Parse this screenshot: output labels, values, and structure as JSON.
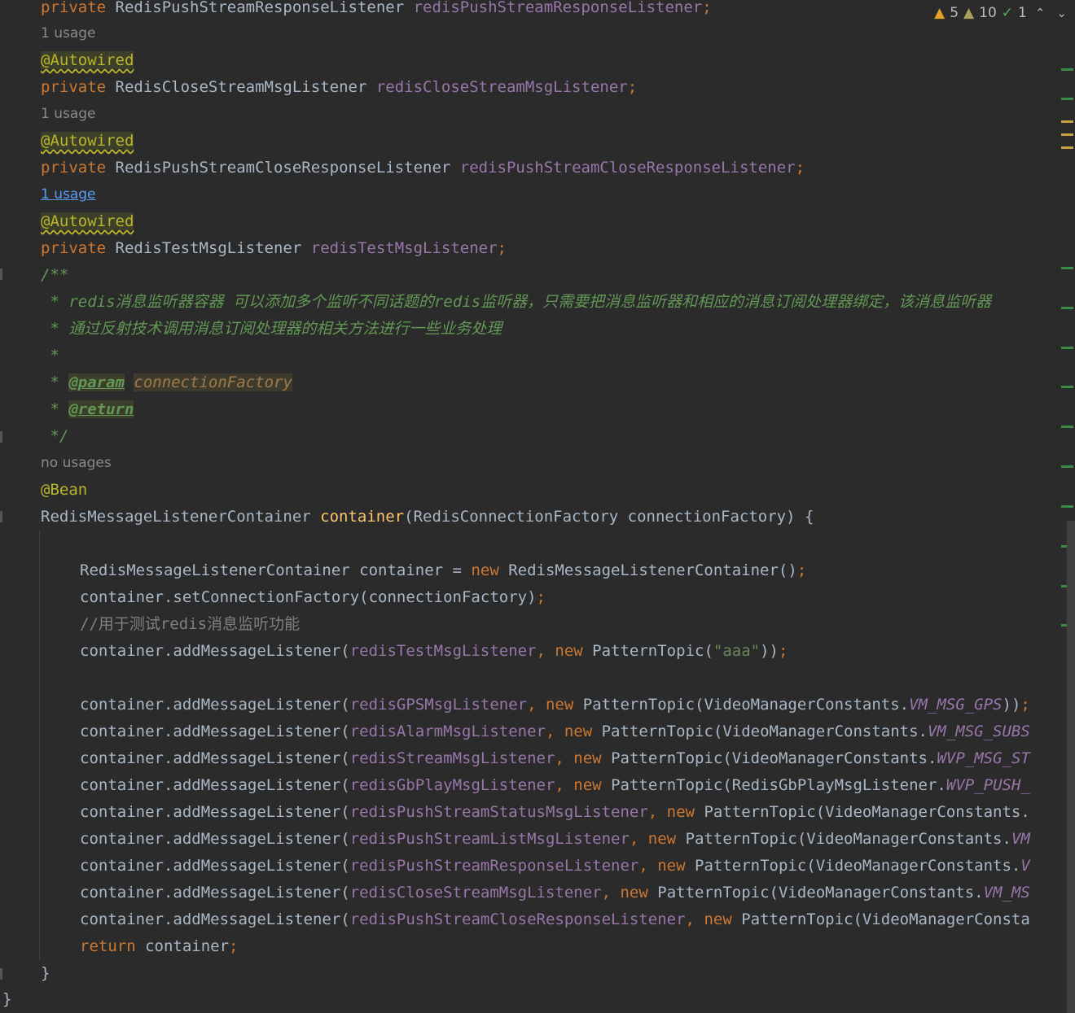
{
  "inspection": {
    "warnings": "5",
    "weak_warnings": "10",
    "typos": "1",
    "warn_icon": "warning-triangle-icon",
    "weak_icon": "weak-warning-triangle-icon",
    "typo_icon": "typo-check-icon",
    "prev_icon": "chevron-up-icon",
    "next_icon": "chevron-down-icon",
    "up_glyph": "⌃",
    "down_glyph": "⌄",
    "warn_glyph": "▲",
    "typo_glyph": "✓"
  },
  "code": {
    "l0": {
      "kw": "private",
      "type": "RedisPushStreamResponseListener",
      "field": "redisPushStreamResponseListener",
      "semi": ";"
    },
    "h1": "1 usage",
    "a1": "@Autowired",
    "l1": {
      "kw": "private",
      "type": "RedisCloseStreamMsgListener",
      "field": "redisCloseStreamMsgListener",
      "semi": ";"
    },
    "h2": "1 usage",
    "a2": "@Autowired",
    "l2": {
      "kw": "private",
      "type": "RedisPushStreamCloseResponseListener",
      "field": "redisPushStreamCloseResponseListener",
      "semi": ";"
    },
    "h3": "1 usage",
    "a3": "@Autowired",
    "l3": {
      "kw": "private",
      "type": "RedisTestMsgListener",
      "field": "redisTestMsgListener",
      "semi": ";"
    },
    "doc_open": "/**",
    "doc1": " * redis消息监听器容器 可以添加多个监听不同话题的redis监听器，只需要把消息监听器和相应的消息订阅处理器绑定，该消息监听器",
    "doc2": " * 通过反射技术调用消息订阅处理器的相关方法进行一些业务处理",
    "doc3": " *",
    "doc4_star": " * ",
    "doc4_tag": "@param",
    "doc4_name": "connectionFactory",
    "doc5_star": " * ",
    "doc5_tag": "@return",
    "doc_close": " */",
    "h4": "no usages",
    "bean": "@Bean",
    "sig": {
      "type": "RedisMessageListenerContainer ",
      "name": "container",
      "rest": "(RedisConnectionFactory connectionFactory) {"
    },
    "b1": {
      "a": "RedisMessageListenerContainer container = ",
      "kw": "new",
      "b": " RedisMessageListenerContainer()",
      "semi": ";"
    },
    "b2": {
      "a": "container.setConnectionFactory(connectionFactory)",
      "semi": ";"
    },
    "b3": "//用于测试redis消息监听功能",
    "b4": {
      "a": "container.addMessageListener(",
      "field": "redisTestMsgListener",
      "c": ", ",
      "kw": "new",
      "d": " PatternTopic(",
      "str": "\"aaa\"",
      "e": "))",
      "semi": ";"
    },
    "r1": {
      "a": "container.addMessageListener(",
      "field": "redisGPSMsgListener",
      "c": ", ",
      "kw": "new",
      "d": " PatternTopic(VideoManagerConstants.",
      "const": "VM_MSG_GPS",
      "e": "))",
      "semi": ";"
    },
    "r2": {
      "a": "container.addMessageListener(",
      "field": "redisAlarmMsgListener",
      "c": ", ",
      "kw": "new",
      "d": " PatternTopic(VideoManagerConstants.",
      "const": "VM_MSG_SUBS"
    },
    "r3": {
      "a": "container.addMessageListener(",
      "field": "redisStreamMsgListener",
      "c": ", ",
      "kw": "new",
      "d": " PatternTopic(VideoManagerConstants.",
      "const": "WVP_MSG_ST"
    },
    "r4": {
      "a": "container.addMessageListener(",
      "field": "redisGbPlayMsgListener",
      "c": ", ",
      "kw": "new",
      "d": " PatternTopic(RedisGbPlayMsgListener.",
      "const": "WVP_PUSH_"
    },
    "r5": {
      "a": "container.addMessageListener(",
      "field": "redisPushStreamStatusMsgListener",
      "c": ", ",
      "kw": "new",
      "d": " PatternTopic(VideoManagerConstants."
    },
    "r6": {
      "a": "container.addMessageListener(",
      "field": "redisPushStreamListMsgListener",
      "c": ", ",
      "kw": "new",
      "d": " PatternTopic(VideoManagerConstants.",
      "const": "VM"
    },
    "r7": {
      "a": "container.addMessageListener(",
      "field": "redisPushStreamResponseListener",
      "c": ", ",
      "kw": "new",
      "d": " PatternTopic(VideoManagerConstants.",
      "const": "V"
    },
    "r8": {
      "a": "container.addMessageListener(",
      "field": "redisCloseStreamMsgListener",
      "c": ", ",
      "kw": "new",
      "d": " PatternTopic(VideoManagerConstants.",
      "const": "VM_MS"
    },
    "r9": {
      "a": "container.addMessageListener(",
      "field": "redisPushStreamCloseResponseListener",
      "c": ", ",
      "kw": "new",
      "d": " PatternTopic(VideoManagerConsta"
    },
    "ret": {
      "kw": "return",
      "a": " container",
      "semi": ";"
    },
    "close_method": "}",
    "close_class": "}"
  },
  "colors": {
    "background": "#2b2b2b",
    "keyword": "#cc7832",
    "field": "#9876aa",
    "method": "#ffc66d",
    "string": "#6a8759",
    "annotation": "#bbb529",
    "comment": "#808080",
    "javadoc": "#629755"
  }
}
